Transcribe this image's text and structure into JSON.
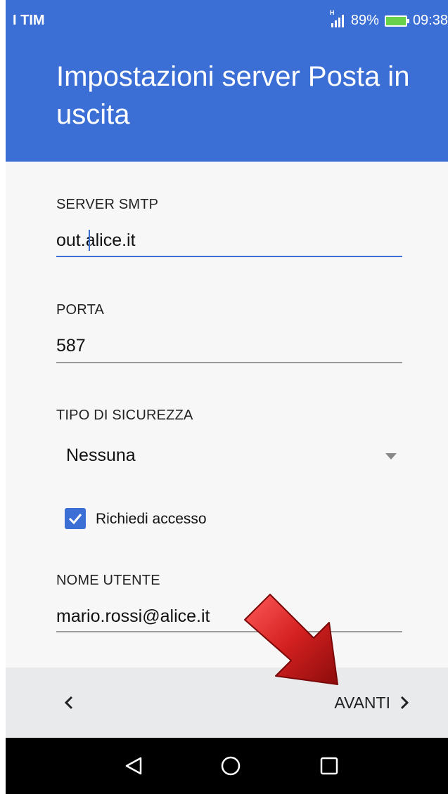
{
  "status_bar": {
    "carrier": "I TIM",
    "network": "H",
    "battery": "89%",
    "time": "09:38"
  },
  "header": {
    "title": "Impostazioni server Posta in uscita"
  },
  "form": {
    "smtp_server": {
      "label": "SERVER SMTP",
      "value": "out.alice.it"
    },
    "port": {
      "label": "PORTA",
      "value": "587"
    },
    "security": {
      "label": "TIPO DI SICUREZZA",
      "selected": "Nessuna"
    },
    "require_login": {
      "label": "Richiedi accesso",
      "checked": true
    },
    "username": {
      "label": "NOME UTENTE",
      "value": "mario.rossi@alice.it"
    }
  },
  "bottom_bar": {
    "back_icon": "chevron-left-icon",
    "next_label": "AVANTI",
    "next_icon": "chevron-right-icon"
  },
  "nav_bar": {
    "icons": [
      "back-triangle-icon",
      "home-circle-icon",
      "recents-square-icon"
    ]
  },
  "colors": {
    "accent": "#3b6fd6",
    "annotation_arrow": "#d42020"
  }
}
